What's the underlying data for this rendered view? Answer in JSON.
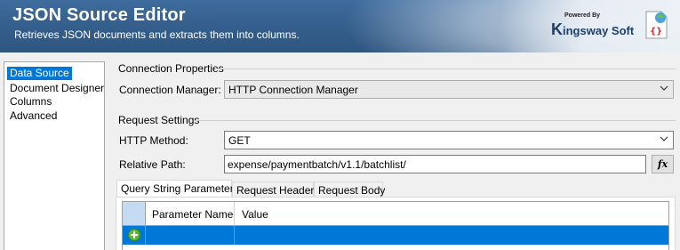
{
  "header": {
    "title": "JSON Source Editor",
    "subtitle": "Retrieves JSON documents and extracts them into columns.",
    "logo_powered": "Powered By",
    "logo_brand_k": "K",
    "logo_brand_rest": "ingsway",
    "logo_brand_soft": "Soft",
    "app_icon": "json-braces-icon"
  },
  "nav": {
    "items": [
      {
        "label": "Data Source",
        "selected": true
      },
      {
        "label": "Document Designer",
        "selected": false
      },
      {
        "label": "Columns",
        "selected": false
      },
      {
        "label": "Advanced",
        "selected": false
      }
    ]
  },
  "connection": {
    "group_label": "Connection Properties",
    "manager_label": "Connection Manager:",
    "manager_value": "HTTP Connection Manager"
  },
  "request": {
    "group_label": "Request Settings",
    "method_label": "HTTP Method:",
    "method_value": "GET",
    "path_label": "Relative Path:",
    "path_value": "expense/paymentbatch/v1.1/batchlist/",
    "fx_label": "fx"
  },
  "tabs": [
    {
      "label": "Query String Parameters",
      "active": true
    },
    {
      "label": "Request Headers",
      "active": false
    },
    {
      "label": "Request Body",
      "active": false
    }
  ],
  "grid": {
    "columns": [
      "Parameter Name",
      "Value"
    ],
    "new_row_icon": "add-row-icon"
  },
  "colors": {
    "header_bg": "#355f8d",
    "selection": "#0078d7",
    "add_icon": "#5fb82d"
  }
}
